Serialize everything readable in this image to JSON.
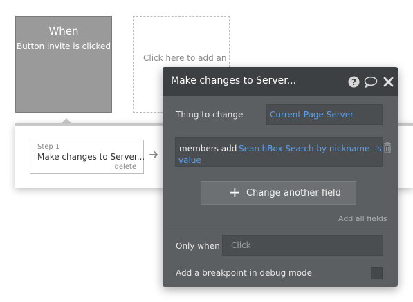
{
  "event": {
    "when_label": "When",
    "trigger_text": "Button invite is clicked"
  },
  "add_event": {
    "label": "Click here to add an"
  },
  "step": {
    "number_label": "Step 1",
    "title": "Make changes to Server...",
    "delete_label": "delete"
  },
  "panel": {
    "title": "Make changes to Server...",
    "thing_to_change_label": "Thing to change",
    "thing_to_change_value": "Current Page Server",
    "field_name": "members add",
    "field_value_part1": "SearchBox Search by nickname..'s",
    "field_value_part2": "value",
    "change_another_field_label": "Change another field",
    "add_all_fields_label": "Add all fields",
    "only_when_label": "Only when",
    "only_when_placeholder": "Click",
    "breakpoint_label": "Add a breakpoint in debug mode"
  },
  "icons": {
    "help": "help-icon",
    "comment": "comment-icon",
    "close": "close-icon",
    "trash": "trash-icon",
    "arrow": "arrow-right-icon",
    "plus": "plus-icon"
  },
  "colors": {
    "event_card": "#9a9a9a",
    "panel_bg": "#5c5f62",
    "panel_header": "#3d4043",
    "link": "#5aa0ee"
  }
}
